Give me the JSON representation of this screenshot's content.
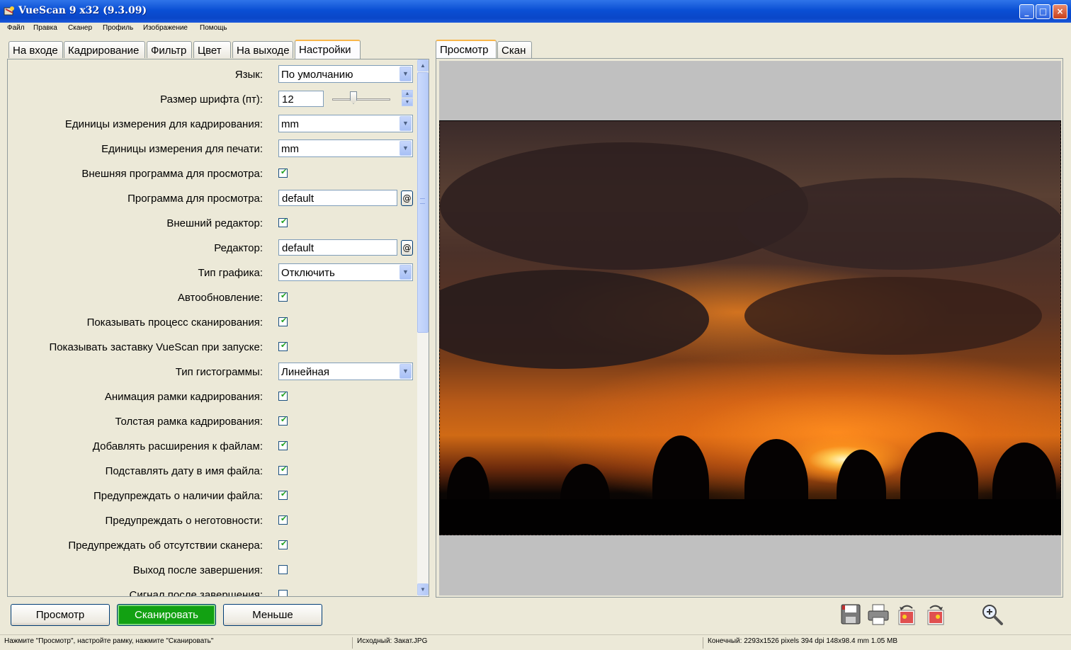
{
  "window": {
    "title": "VueScan 9 x32 (9.3.09)",
    "minimize": "_",
    "maximize": "□",
    "close": "×"
  },
  "menu": [
    "Файл",
    "Правка",
    "Сканер",
    "Профиль",
    "Изображение",
    "Помощь"
  ],
  "left_tabs": [
    "На входе",
    "Кадрирование",
    "Фильтр",
    "Цвет",
    "На выходе",
    "Настройки"
  ],
  "right_tabs": [
    "Просмотр",
    "Скан"
  ],
  "settings": {
    "language": {
      "label": "Язык:",
      "value": "По умолчанию"
    },
    "font_size": {
      "label": "Размер шрифта (пт):",
      "value": "12"
    },
    "crop_units": {
      "label": "Единицы измерения для кадрирования:",
      "value": "mm"
    },
    "print_units": {
      "label": "Единицы измерения для печати:",
      "value": "mm"
    },
    "external_viewer": {
      "label": "Внешняя программа для просмотра:",
      "checked": true
    },
    "viewer_program": {
      "label": "Программа для просмотра:",
      "value": "default",
      "button": "@"
    },
    "external_editor": {
      "label": "Внешний редактор:",
      "checked": true
    },
    "editor": {
      "label": "Редактор:",
      "value": "default",
      "button": "@"
    },
    "graph_type": {
      "label": "Тип графика:",
      "value": "Отключить"
    },
    "auto_update": {
      "label": "Автообновление:",
      "checked": true
    },
    "show_progress": {
      "label": "Показывать процесс сканирования:",
      "checked": true
    },
    "show_splash": {
      "label": "Показывать заставку VueScan при запуске:",
      "checked": true
    },
    "histogram_type": {
      "label": "Тип гистограммы:",
      "value": "Линейная"
    },
    "animate_crop": {
      "label": "Анимация рамки кадрирования:",
      "checked": true
    },
    "thick_crop": {
      "label": "Толстая рамка кадрирования:",
      "checked": true
    },
    "add_extensions": {
      "label": "Добавлять расширения к файлам:",
      "checked": true
    },
    "date_in_filename": {
      "label": "Подставлять дату в имя файла:",
      "checked": true
    },
    "warn_file_exists": {
      "label": "Предупреждать о наличии файла:",
      "checked": true
    },
    "warn_not_ready": {
      "label": "Предупреждать о неготовности:",
      "checked": true
    },
    "warn_no_scanner": {
      "label": "Предупреждать об отсутствии сканера:",
      "checked": true
    },
    "exit_when_done": {
      "label": "Выход после завершения:",
      "checked": false
    },
    "beep_when_done": {
      "label": "Сигнал после завершения:",
      "checked": false
    }
  },
  "buttons": {
    "preview": "Просмотр",
    "scan": "Сканировать",
    "less": "Меньше"
  },
  "toolbar_icons": [
    "save-icon",
    "print-icon",
    "rotate-left-icon",
    "rotate-right-icon",
    "zoom-in-icon"
  ],
  "status": {
    "hint": "Нажмите \"Просмотр\", настройте рамку, нажмите \"Сканировать\"",
    "source": "Исходный: Закат.JPG",
    "output": "Конечный: 2293x1526 pixels 394 dpi 148x98.4 mm 1.05 MB"
  },
  "colors": {
    "titlebar": "#0a4fd4",
    "active_tab": "#f7b64b",
    "scan_button": "#12a112",
    "checkmark": "#21a121"
  }
}
